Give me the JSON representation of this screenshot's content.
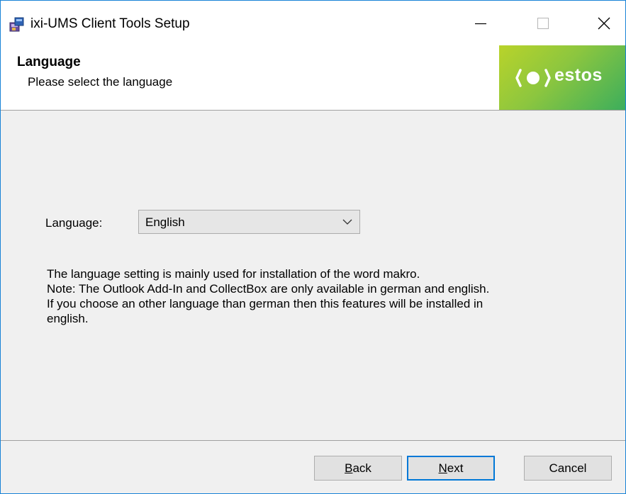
{
  "window": {
    "title": "ixi-UMS Client Tools Setup",
    "accent_color": "#1883d7"
  },
  "title_controls": {
    "minimize_icon": "minimize-icon",
    "maximize_icon": "maximize-icon",
    "close_icon": "close-icon"
  },
  "header": {
    "title": "Language",
    "subtitle": "Please select the language",
    "logo_text": "estos",
    "logo_colors": [
      "#b9d32a",
      "#3cae5c"
    ]
  },
  "form": {
    "language_label": "Language:",
    "language_value": "English"
  },
  "info": {
    "lines": [
      "The language setting is mainly used for installation of the word makro.",
      "Note: The Outlook Add-In and CollectBox are only available in german and english.",
      "If you choose an other language than german then this features will be installed in",
      "english."
    ]
  },
  "buttons": {
    "back_first": "B",
    "back_rest": "ack",
    "next_first": "N",
    "next_rest": "ext",
    "cancel": "Cancel"
  }
}
